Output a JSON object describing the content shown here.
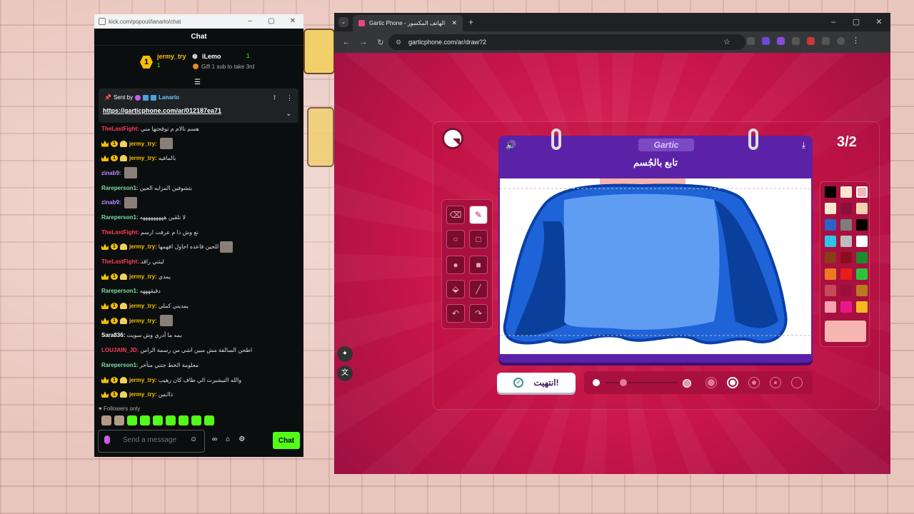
{
  "kick_window": {
    "url": "kick.com/popout/lanarlo/chat",
    "header": "Chat",
    "leaderboard": {
      "first_rank": "1",
      "first_name": "jermy_try",
      "first_count": "1",
      "second_name": "iLemo",
      "second_count": "1",
      "gift_text": "Gift 1 sub to take 3rd"
    },
    "pinned": {
      "sent_by": "Sent by",
      "user": "Lanarlo",
      "link": "https://garticphone.com/ar/012187ea71"
    },
    "messages": [
      {
        "user": "TheLastFight",
        "color": "#ff3b5c",
        "badges": false,
        "text": "هسم نالام م توقحتها مني",
        "emote": false
      },
      {
        "user": "jermy_try",
        "color": "#f7c000",
        "badges": true,
        "text": "",
        "emote": true
      },
      {
        "user": "jermy_try",
        "color": "#f7c000",
        "badges": true,
        "text": "بالمافيه",
        "emote": false
      },
      {
        "user": "zinab9",
        "color": "#b68cff",
        "badges": false,
        "text": "",
        "emote": true
      },
      {
        "user": "Rareperson1",
        "color": "#7be0a6",
        "badges": false,
        "text": "بتشوفين المزايه الحين",
        "emote": false
      },
      {
        "user": "zinab9",
        "color": "#b68cff",
        "badges": false,
        "text": "",
        "emote": true
      },
      {
        "user": "Rareperson1",
        "color": "#7be0a6",
        "badges": false,
        "text": "لا تلقين هههههههههه",
        "emote": false
      },
      {
        "user": "TheLastFight",
        "color": "#ff3b5c",
        "badges": false,
        "text": "نع وش ذا م عرفت ارسم",
        "emote": false
      },
      {
        "user": "jermy_try",
        "color": "#f7c000",
        "badges": true,
        "text": "للحين قاعده احاول افهمها",
        "emote": true
      },
      {
        "user": "TheLastFight",
        "color": "#ff3b5c",
        "badges": false,
        "text": "ليتني راقد",
        "emote": false
      },
      {
        "user": "jermy_try",
        "color": "#f7c000",
        "badges": true,
        "text": "يمدي",
        "emote": false
      },
      {
        "user": "Rareperson1",
        "color": "#7be0a6",
        "badges": false,
        "text": "دقيقهههه",
        "emote": false
      },
      {
        "user": "jermy_try",
        "color": "#f7c000",
        "badges": true,
        "text": "يمديني كملي",
        "emote": false
      },
      {
        "user": "jermy_try",
        "color": "#f7c000",
        "badges": true,
        "text": "",
        "emote": true
      },
      {
        "user": "Sara836",
        "color": "#ffffff",
        "badges": false,
        "text": "يمه ما أدري وش سويت",
        "emote": false
      },
      {
        "user": "LOUJAIN_JD",
        "color": "#ff3b5c",
        "badges": false,
        "text": "اطحن السالفة مش مبين اشي من رسمة الراس",
        "emote": false
      },
      {
        "user": "Rareperson1",
        "color": "#7be0a6",
        "badges": false,
        "text": "معلومة الخط جتني متأخر",
        "emote": false
      },
      {
        "user": "jermy_try",
        "color": "#f7c000",
        "badges": true,
        "text": "والله التيشيرت الي طاف كان رهيب",
        "emote": false
      },
      {
        "user": "jermy_try",
        "color": "#f7c000",
        "badges": true,
        "text": "ذاايس",
        "emote": false
      }
    ],
    "followers_only": "Followers only",
    "input_placeholder": "Send a message",
    "chat_button": "Chat"
  },
  "browser": {
    "tab_title": "Gartic Phone - الهاتف المكسور",
    "url": "garticphone.com/ar/draw?2"
  },
  "game": {
    "brand": "Gartic",
    "round": "3/2",
    "prompt": "تابع بالجُسم",
    "done_label": "انتهيت!",
    "palette": [
      "#000000",
      "#f9e5d2",
      "#f7b5b0",
      "#fbe7d3",
      "#8a0f3a",
      "#f7d3b3",
      "#2d63c8",
      "#7d7d7d",
      "#000000",
      "#2ec4ea",
      "#bdbdbd",
      "#ffffff",
      "#8a3d1a",
      "#8a0f1a",
      "#1e8a2e",
      "#f07a1e",
      "#e81c1c",
      "#2ec43a",
      "#c84a5a",
      "#9c0f3a",
      "#b97a1e",
      "#f7a0b0",
      "#e8178a",
      "#f7b81e"
    ],
    "selected_color": "#f7b5b0"
  }
}
